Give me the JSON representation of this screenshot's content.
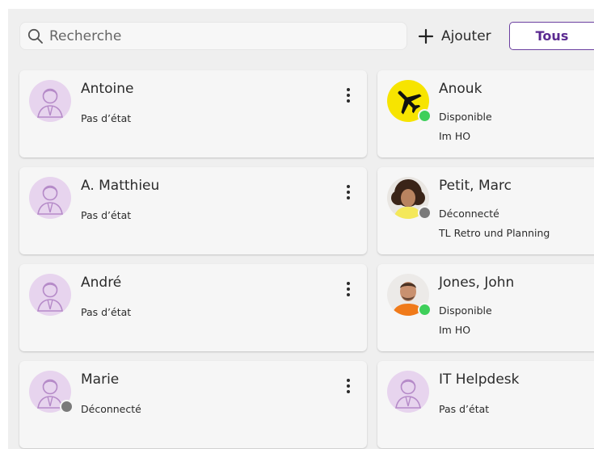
{
  "toolbar": {
    "search": {
      "placeholder": "Recherche",
      "value": ""
    },
    "add_label": "Ajouter",
    "filter_label": "Tous"
  },
  "colors": {
    "accent": "#6b3fa0",
    "available": "#3ecf5a",
    "offline": "#7a7a7a",
    "avatar_placeholder": "#e7d4ee"
  },
  "contacts_left": [
    {
      "name": "Antoine",
      "status": "Pas d’état",
      "presence": "none",
      "avatar": "person-placeholder-icon"
    },
    {
      "name": "A. Matthieu",
      "status": "Pas d’état",
      "presence": "none",
      "avatar": "person-placeholder-icon"
    },
    {
      "name": "André",
      "status": "Pas d’état",
      "presence": "none",
      "avatar": "person-placeholder-icon"
    },
    {
      "name": "Marie",
      "status": "Déconnecté",
      "presence": "offline",
      "avatar": "person-placeholder-icon"
    }
  ],
  "contacts_right": [
    {
      "name": "Anouk",
      "status": "Disponible",
      "note": "Im HO",
      "presence": "available",
      "avatar": "airplane-icon"
    },
    {
      "name": "Petit, Marc",
      "status": "Déconnecté",
      "note": "TL Retro und Planning",
      "presence": "offline",
      "avatar": "photo-avatar"
    },
    {
      "name": "Jones, John",
      "status": "Disponible",
      "note": "Im HO",
      "presence": "available",
      "avatar": "photo-avatar"
    },
    {
      "name": "IT Helpdesk",
      "status": "Pas d’état",
      "presence": "none",
      "avatar": "person-placeholder-icon"
    }
  ]
}
